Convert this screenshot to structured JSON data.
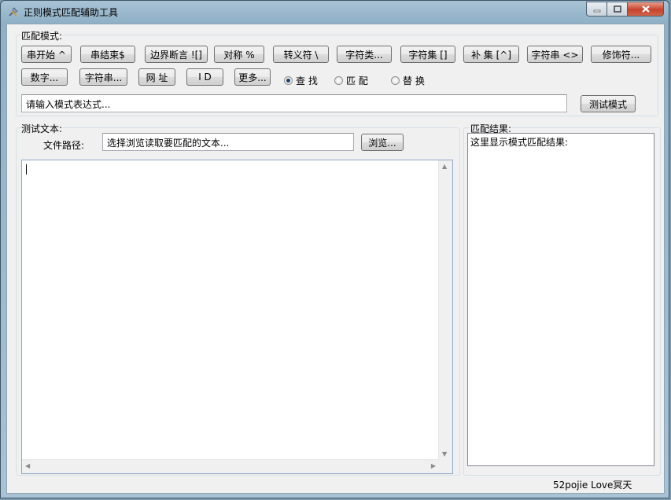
{
  "window": {
    "title": "正则模式匹配辅助工具"
  },
  "pattern_group": {
    "label": "匹配模式:",
    "row1": [
      "串开始 ^",
      "串结束$",
      "边界断言 ![]",
      "对称 %",
      "转义符 \\",
      "字符类...",
      "字符集 []",
      "补 集 [^]",
      "字符串 <>",
      "修饰符..."
    ],
    "row2": [
      "数字...",
      "字符串...",
      "网 址",
      "I D",
      "更多..."
    ],
    "radios": [
      {
        "label": "查 找",
        "selected": true
      },
      {
        "label": "匹 配",
        "selected": false
      },
      {
        "label": "替 换",
        "selected": false
      }
    ],
    "pattern_input": "请输入模式表达式...",
    "test_button": "测试模式"
  },
  "test_group": {
    "label": "测试文本:",
    "file_path_label": "文件路径:",
    "file_path_value": "选择浏览读取要匹配的文本...",
    "browse_button": "浏览..."
  },
  "result_group": {
    "label": "匹配结果:",
    "text": "这里显示模式匹配结果:"
  },
  "footer": {
    "text": "52pojie Love冥天"
  }
}
